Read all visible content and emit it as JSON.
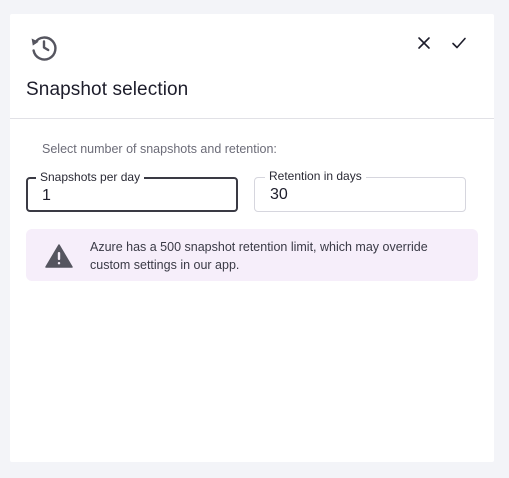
{
  "dialog": {
    "title": "Snapshot selection",
    "icons": {
      "header": "history-icon",
      "close": "close-icon",
      "confirm": "check-icon"
    },
    "subtitle": "Select number of snapshots and retention:",
    "fields": {
      "snapshots_per_day": {
        "label": "Snapshots per day",
        "value": "1"
      },
      "retention_days": {
        "label": "Retention in days",
        "value": "30"
      }
    },
    "alert": {
      "icon": "warning-icon",
      "text": "Azure has a 500 snapshot retention limit, which may override custom settings in our app."
    }
  },
  "colors": {
    "page_background": "#f3f4f8",
    "panel_background": "#ffffff",
    "alert_background": "#f6eefa",
    "alert_icon": "#55555f",
    "text_primary": "#1d1d2b",
    "text_secondary": "#6c6c78"
  }
}
